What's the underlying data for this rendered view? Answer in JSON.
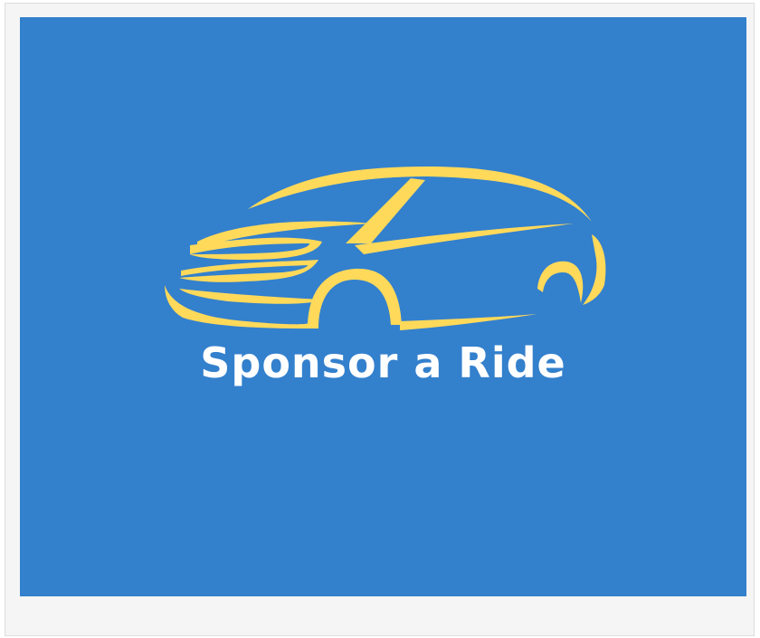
{
  "banner": {
    "title": "Sponsor a Ride",
    "background_color": "#3380cd",
    "logo_color": "#ffd95a",
    "logo_icon": "car-outline-icon"
  }
}
